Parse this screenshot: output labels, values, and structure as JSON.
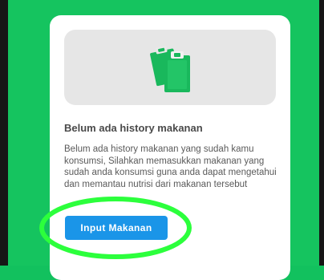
{
  "empty_state": {
    "illustration_icon": "clipboard-icon",
    "title": "Belum ada history makanan",
    "description": "Belum ada history makanan yang sudah kamu konsumsi, Silahkan memasukkan makanan yang sudah anda konsumsi guna anda dapat mengetahui dan memantau nutrisi dari makanan tersebut",
    "button_label": "Input Makanan"
  },
  "colors": {
    "background": "#12c15e",
    "accent": "#1a95e8",
    "icon_green": "#19b85c",
    "annotation": "#2cff3c"
  }
}
